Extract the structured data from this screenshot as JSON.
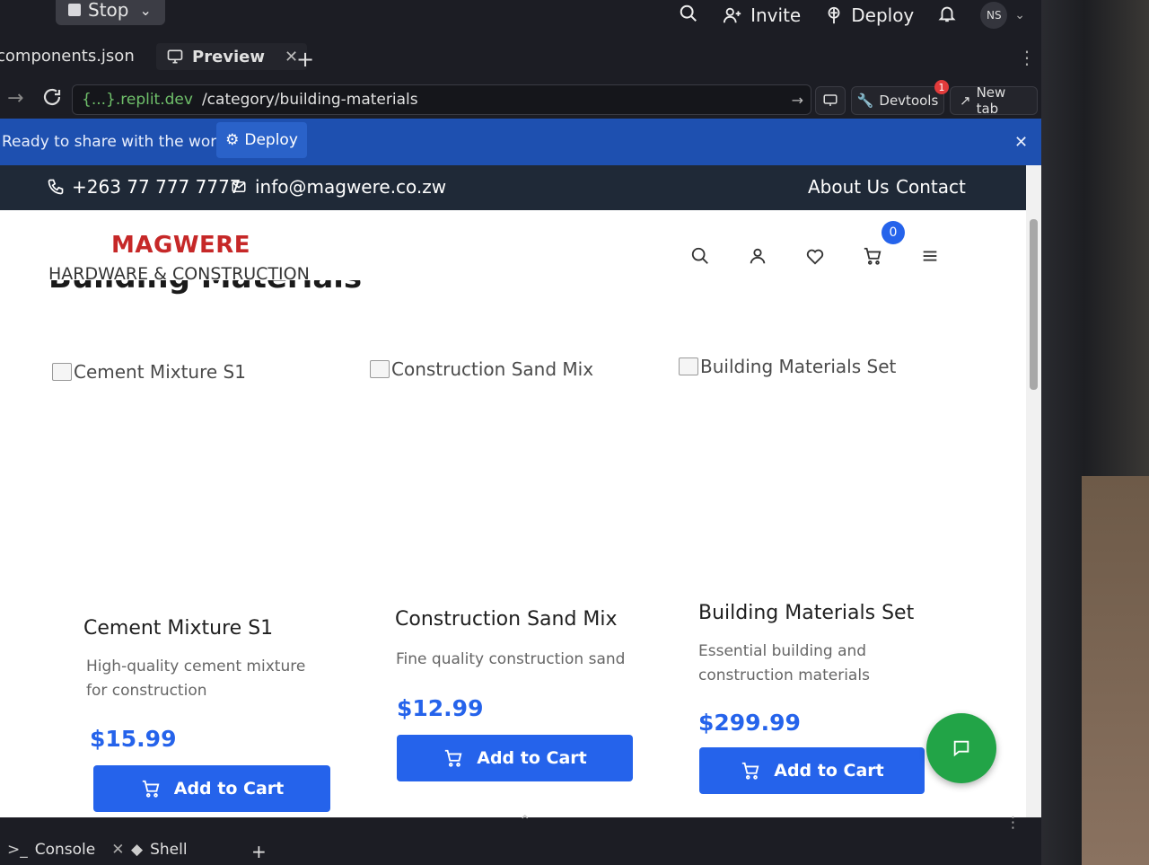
{
  "header": {
    "stop_label": "Stop",
    "invite_label": "Invite",
    "deploy_label": "Deploy",
    "avatar_initials": "NS"
  },
  "tabs": {
    "file_tab": "components.json",
    "preview_tab": "Preview"
  },
  "browser": {
    "domain": "{...}.replit.dev",
    "path": "/category/building-materials",
    "devtools_label": "Devtools",
    "devtools_count": "1",
    "newtab_label": "New tab"
  },
  "banner": {
    "text": "Ready to share with the world?",
    "deploy_label": "Deploy"
  },
  "site": {
    "phone": "+263 77 777 7777",
    "email": "info@magwere.co.zw",
    "nav": [
      "About Us",
      "Contact"
    ],
    "brand_name": "MAGWERE",
    "brand_tagline": "HARDWARE & CONSTRUCTION",
    "cart_count": "0",
    "page_heading": "Building Materials",
    "brand_color": "#c62828",
    "accent_color": "#2563eb"
  },
  "products": [
    {
      "alt": "Cement Mixture S1",
      "name": "Cement Mixture S1",
      "desc": "High-quality cement mixture for construction",
      "price": "$15.99",
      "button": "Add to Cart"
    },
    {
      "alt": "Construction Sand Mix",
      "name": "Construction Sand Mix",
      "desc": "Fine quality construction sand",
      "price": "$12.99",
      "button": "Add to Cart"
    },
    {
      "alt": "Building Materials Set",
      "name": "Building Materials Set",
      "desc": "Essential building and construction materials",
      "price": "$299.99",
      "button": "Add to Cart"
    }
  ],
  "bottom": {
    "console_label": "Console",
    "shell_label": "Shell"
  }
}
